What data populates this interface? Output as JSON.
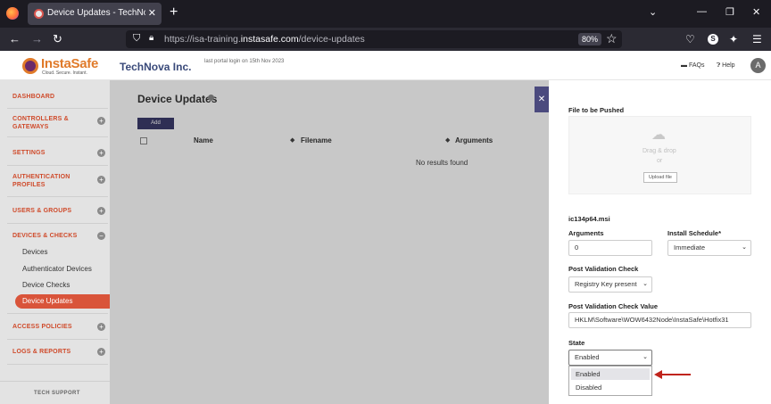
{
  "browser": {
    "tab_title": "Device Updates - TechNova Inc",
    "tab_close": "✕",
    "new_tab": "+",
    "url_prefix": "https://isa-training.",
    "url_domain": "instasafe.com",
    "url_path": "/device-updates",
    "zoom": "80%",
    "profile_initial": "S",
    "win_min": "⌄",
    "win_minimize": "—",
    "win_restore": "❐",
    "win_close": "✕"
  },
  "header": {
    "logo_text": "InstaSafe",
    "logo_tagline": "Cloud. Secure. Instant.",
    "company": "TechNova Inc.",
    "last_login": "last portal login on 15th Nov 2023",
    "faqs": "FAQs",
    "help": "Help",
    "avatar": "A"
  },
  "sidebar": {
    "items": [
      {
        "label": "DASHBOARD"
      },
      {
        "label": "CONTROLLERS & GATEWAYS"
      },
      {
        "label": "SETTINGS"
      },
      {
        "label": "AUTHENTICATION PROFILES"
      },
      {
        "label": "USERS & GROUPS"
      },
      {
        "label": "DEVICES & CHECKS"
      },
      {
        "label": "ACCESS POLICIES"
      },
      {
        "label": "LOGS & REPORTS"
      }
    ],
    "sub_items": [
      "Devices",
      "Authenticator Devices",
      "Device Checks",
      "Device Updates"
    ],
    "tech_support": "TECH SUPPORT"
  },
  "main": {
    "title": "Device Updates",
    "add_label": "Add",
    "columns": [
      "Name",
      "Filename",
      "Arguments"
    ],
    "empty_text": "No results found"
  },
  "panel": {
    "file_label": "File to be Pushed",
    "drag_text": "Drag & drop",
    "or_text": "or",
    "upload_label": "Upload file",
    "file_name": "ic134p64.msi",
    "arguments_label": "Arguments",
    "arguments_value": "0",
    "schedule_label": "Install Schedule*",
    "schedule_value": "Immediate",
    "pvc_label": "Post Validation Check",
    "pvc_value": "Registry Key present",
    "pvcv_label": "Post Validation Check Value",
    "pvcv_value": "HKLM\\Software\\WOW6432Node\\InstaSafe\\Hotfix31",
    "state_label": "State",
    "state_value": "Enabled",
    "state_options": [
      "Enabled",
      "Disabled"
    ]
  },
  "colors": {
    "accent_orange": "#d9543a",
    "nav_dark": "#3a3a6a",
    "annotation_red": "#c0241c"
  }
}
